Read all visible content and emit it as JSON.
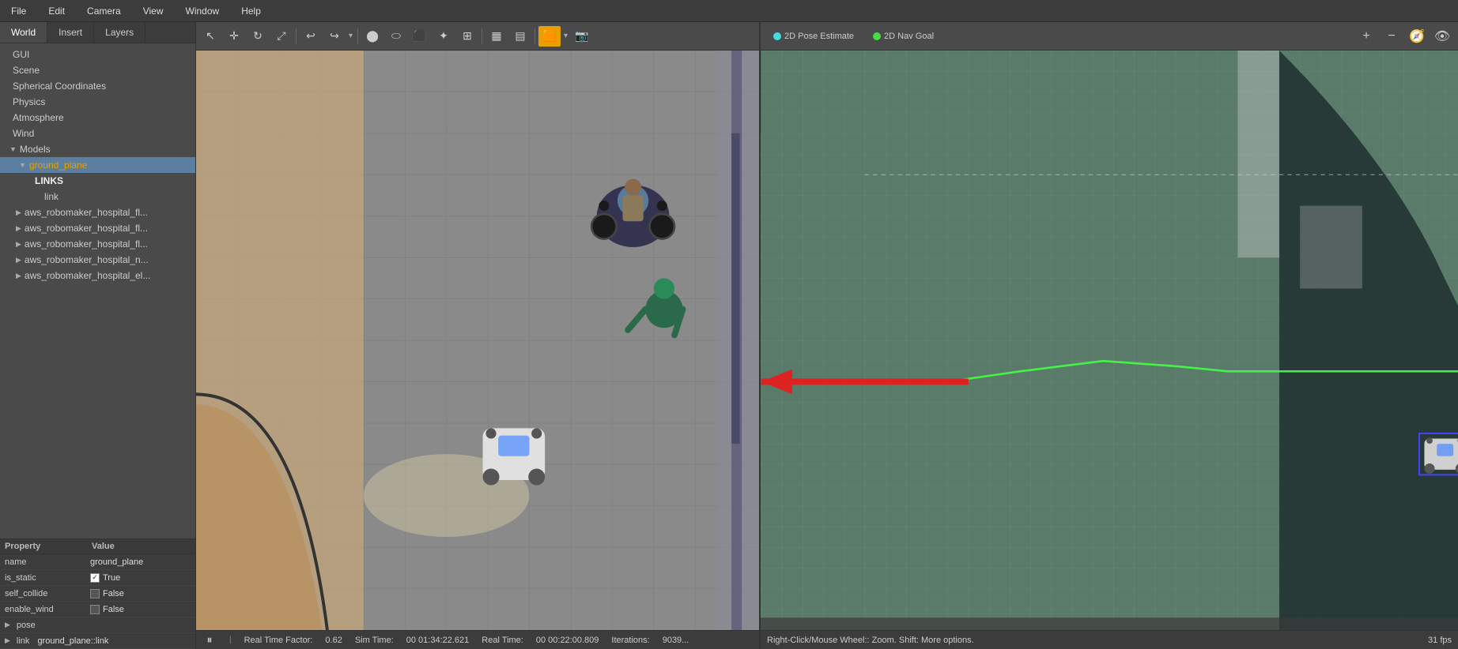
{
  "menubar": {
    "items": [
      "File",
      "Edit",
      "Camera",
      "View",
      "Window",
      "Help"
    ]
  },
  "left_panel": {
    "tabs": [
      {
        "label": "World",
        "active": true
      },
      {
        "label": "Insert",
        "active": false
      },
      {
        "label": "Layers",
        "active": false
      }
    ],
    "tree": {
      "items": [
        {
          "label": "GUI",
          "level": 0,
          "arrow": false
        },
        {
          "label": "Scene",
          "level": 0,
          "arrow": false
        },
        {
          "label": "Spherical Coordinates",
          "level": 0,
          "arrow": false
        },
        {
          "label": "Physics",
          "level": 0,
          "arrow": false
        },
        {
          "label": "Atmosphere",
          "level": 0,
          "arrow": false
        },
        {
          "label": "Wind",
          "level": 0,
          "arrow": false
        },
        {
          "label": "Models",
          "level": 0,
          "arrow": true,
          "expanded": true
        },
        {
          "label": "ground_plane",
          "level": 1,
          "arrow": true,
          "expanded": true,
          "orange": true
        },
        {
          "label": "LINKS",
          "level": 2,
          "arrow": false,
          "bold": true
        },
        {
          "label": "link",
          "level": 3,
          "arrow": false
        },
        {
          "label": "aws_robomaker_hospital_fl...",
          "level": 1,
          "arrow": true
        },
        {
          "label": "aws_robomaker_hospital_fl...",
          "level": 1,
          "arrow": true
        },
        {
          "label": "aws_robomaker_hospital_fl...",
          "level": 1,
          "arrow": true
        },
        {
          "label": "aws_robomaker_hospital_n...",
          "level": 1,
          "arrow": true
        },
        {
          "label": "aws_robomaker_hospital_el...",
          "level": 1,
          "arrow": true
        }
      ]
    },
    "properties": {
      "header": {
        "col1": "Property",
        "col2": "Value"
      },
      "rows": [
        {
          "key": "name",
          "value": "ground_plane",
          "type": "text"
        },
        {
          "key": "is_static",
          "value": "True",
          "type": "checkbox_true"
        },
        {
          "key": "self_collide",
          "value": "False",
          "type": "checkbox_false"
        },
        {
          "key": "enable_wind",
          "value": "False",
          "type": "checkbox_false"
        },
        {
          "key": "pose",
          "value": "",
          "type": "section"
        },
        {
          "key": "link",
          "value": "ground_plane::link",
          "type": "section_value"
        }
      ]
    }
  },
  "viewport_toolbar": {
    "tools": [
      "cursor",
      "translate",
      "rotate",
      "scale",
      "undo",
      "redo",
      "separator",
      "sphere",
      "cylinder",
      "box",
      "light",
      "mesh",
      "separator2",
      "model1",
      "model2",
      "separator3",
      "camera",
      "record",
      "screenshot",
      "menu"
    ]
  },
  "statusbar": {
    "paused": true,
    "real_time_factor_label": "Real Time Factor:",
    "real_time_factor": "0.62",
    "sim_time_label": "Sim Time:",
    "sim_time": "00 01:34:22.621",
    "real_time_label": "Real Time:",
    "real_time": "00 00:22:00.809",
    "iterations_label": "Iterations:",
    "iterations": "9039..."
  },
  "rviz": {
    "toolbar": {
      "pose_estimate_label": "2D Pose Estimate",
      "nav_goal_label": "2D Nav Goal",
      "buttons": [
        "+",
        "-",
        "compass",
        "camera3d"
      ]
    },
    "map": {
      "bg_color": "#5a7a6a",
      "grid_color": "#6a8a7a"
    },
    "statusbar": {
      "hint": "Right-Click/Mouse Wheel:: Zoom. Shift: More options.",
      "fps": "31 fps"
    }
  }
}
